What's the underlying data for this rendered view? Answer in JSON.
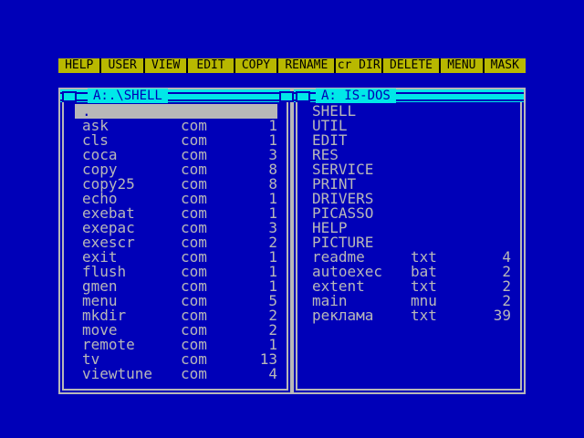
{
  "toolbar": [
    {
      "label": "HELP",
      "w": 44
    },
    {
      "label": "USER",
      "w": 44
    },
    {
      "label": "VIEW",
      "w": 44
    },
    {
      "label": "EDIT",
      "w": 48
    },
    {
      "label": "COPY",
      "w": 44
    },
    {
      "label": "RENAME",
      "w": 60
    },
    {
      "label": "cr DIR",
      "w": 48
    },
    {
      "label": "DELETE",
      "w": 60
    },
    {
      "label": "MENU",
      "w": 44
    },
    {
      "label": "MASK",
      "w": 44
    }
  ],
  "left_panel": {
    "title": "A:.\\SHELL",
    "files": [
      {
        "name": ".",
        "ext": "",
        "size": "",
        "selected": true
      },
      {
        "name": "ask",
        "ext": "com",
        "size": "1"
      },
      {
        "name": "cls",
        "ext": "com",
        "size": "1"
      },
      {
        "name": "coca",
        "ext": "com",
        "size": "3"
      },
      {
        "name": "copy",
        "ext": "com",
        "size": "8"
      },
      {
        "name": "copy25",
        "ext": "com",
        "size": "8"
      },
      {
        "name": "echo",
        "ext": "com",
        "size": "1"
      },
      {
        "name": "exebat",
        "ext": "com",
        "size": "1"
      },
      {
        "name": "exepac",
        "ext": "com",
        "size": "3"
      },
      {
        "name": "exescr",
        "ext": "com",
        "size": "2"
      },
      {
        "name": "exit",
        "ext": "com",
        "size": "1"
      },
      {
        "name": "flush",
        "ext": "com",
        "size": "1"
      },
      {
        "name": "gmen",
        "ext": "com",
        "size": "1"
      },
      {
        "name": "menu",
        "ext": "com",
        "size": "5"
      },
      {
        "name": "mkdir",
        "ext": "com",
        "size": "2"
      },
      {
        "name": "move",
        "ext": "com",
        "size": "2"
      },
      {
        "name": "remote",
        "ext": "com",
        "size": "1"
      },
      {
        "name": "tv",
        "ext": "com",
        "size": "13"
      },
      {
        "name": "viewtune",
        "ext": "com",
        "size": "4"
      }
    ]
  },
  "right_panel": {
    "title": "A: IS-DOS",
    "files": [
      {
        "name": "SHELL",
        "ext": "",
        "size": ""
      },
      {
        "name": "UTIL",
        "ext": "",
        "size": ""
      },
      {
        "name": "EDIT",
        "ext": "",
        "size": ""
      },
      {
        "name": "RES",
        "ext": "",
        "size": ""
      },
      {
        "name": "SERVICE",
        "ext": "",
        "size": ""
      },
      {
        "name": "PRINT",
        "ext": "",
        "size": ""
      },
      {
        "name": "DRIVERS",
        "ext": "",
        "size": ""
      },
      {
        "name": "PICASSO",
        "ext": "",
        "size": ""
      },
      {
        "name": "HELP",
        "ext": "",
        "size": ""
      },
      {
        "name": "PICTURE",
        "ext": "",
        "size": ""
      },
      {
        "name": "readme",
        "ext": "txt",
        "size": "4"
      },
      {
        "name": "autoexec",
        "ext": "bat",
        "size": "2"
      },
      {
        "name": "extent",
        "ext": "txt",
        "size": "2"
      },
      {
        "name": "main",
        "ext": "mnu",
        "size": "2"
      },
      {
        "name": "реклама",
        "ext": "txt",
        "size": "39"
      }
    ]
  },
  "colors": {
    "background": "#0000b8",
    "toolbar_button": "#b8b800",
    "titlebar": "#00e8e8",
    "text": "#b8b8b8"
  },
  "icons": {
    "panel_window": "square-icon"
  }
}
